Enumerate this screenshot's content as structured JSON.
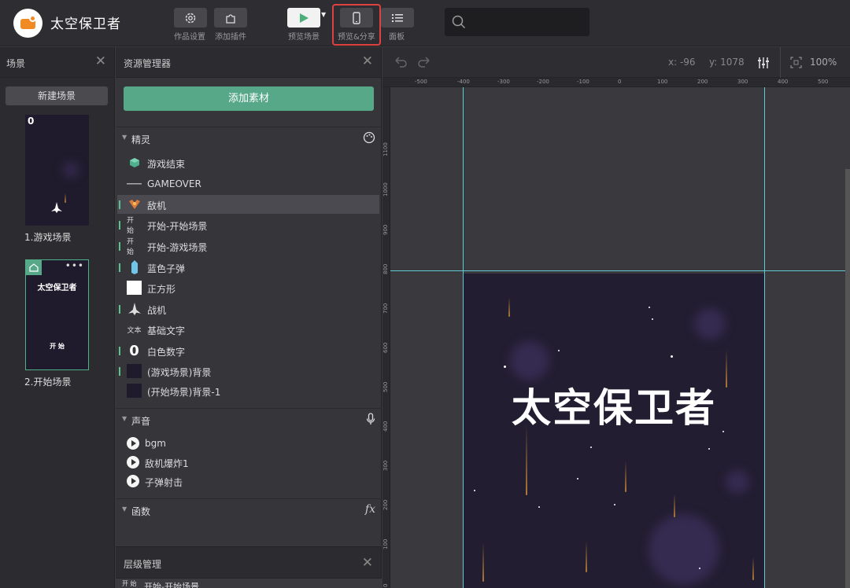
{
  "app": {
    "title": "太空保卫者"
  },
  "toolbar": {
    "settings_label": "作品设置",
    "plugins_label": "添加插件",
    "preview_scene_label": "预览场景",
    "preview_share_label": "预览&分享",
    "panel_label": "面板",
    "search_placeholder": ""
  },
  "scenes": {
    "title": "场景",
    "new_scene_label": "新建场景",
    "items": [
      {
        "label": "1.游戏场景",
        "score": "0"
      },
      {
        "label": "2.开始场景",
        "title": "太空保卫者",
        "start": "开 始"
      }
    ]
  },
  "assets": {
    "title": "资源管理器",
    "add_label": "添加素材",
    "sprites_title": "精灵",
    "sprites": [
      {
        "label": "游戏结束",
        "icon": "cube-icon"
      },
      {
        "label": "GAMEOVER",
        "icon": "text-line-icon"
      },
      {
        "label": "敌机",
        "icon": "enemy-ship-icon"
      },
      {
        "label": "开始-开始场景",
        "icon_text": "开 始"
      },
      {
        "label": "开始-游戏场景",
        "icon_text": "开 始"
      },
      {
        "label": "蓝色子弹",
        "icon": "bullet-icon"
      },
      {
        "label": "正方形",
        "icon": "square-icon"
      },
      {
        "label": "战机",
        "icon": "fighter-icon"
      },
      {
        "label": "基础文字",
        "icon_text": "文本"
      },
      {
        "label": "白色数字",
        "icon_text": "0"
      },
      {
        "label": "(游戏场景)背景",
        "icon": "bg-thumb-icon"
      },
      {
        "label": "(开始场景)背景-1",
        "icon": "bg-thumb-icon"
      }
    ],
    "sounds_title": "声音",
    "sounds": [
      {
        "label": "bgm"
      },
      {
        "label": "敌机爆炸1"
      },
      {
        "label": "子弹射击"
      }
    ],
    "functions_title": "函数",
    "functions_icon_text": "fx"
  },
  "layers": {
    "title": "层级管理",
    "first_item": "开始-开始场景",
    "first_icon_text": "开 始"
  },
  "canvas": {
    "x_label": "x: -96",
    "y_label": "y: 1078",
    "zoom": "100%",
    "ruler_h": [
      "-500",
      "-400",
      "-300",
      "-200",
      "-100",
      "0",
      "100",
      "200",
      "300",
      "400",
      "500"
    ],
    "ruler_v": [
      "1100",
      "1000",
      "900",
      "800",
      "700",
      "600",
      "500",
      "400",
      "300",
      "200",
      "100",
      "0"
    ],
    "stage_title": "太空保卫者"
  },
  "colors": {
    "accent": "#57a888",
    "guide": "#5fc9d4",
    "highlight": "#e0413e",
    "stage_bg": "#221d31"
  }
}
